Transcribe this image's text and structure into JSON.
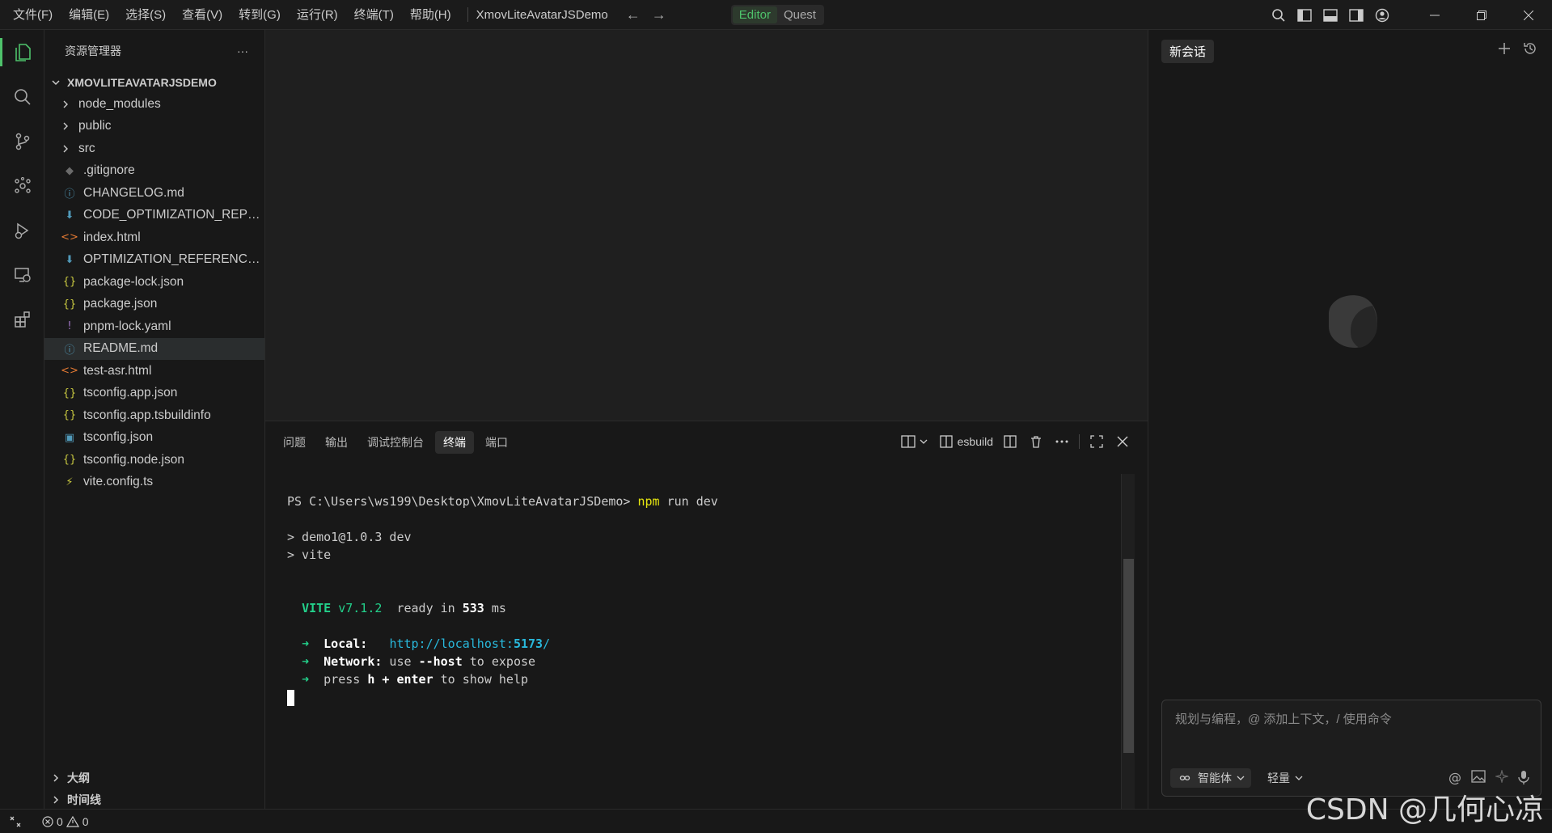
{
  "menu": [
    "文件(F)",
    "编辑(E)",
    "选择(S)",
    "查看(V)",
    "转到(G)",
    "运行(R)",
    "终端(T)",
    "帮助(H)"
  ],
  "window_title": "XmovLiteAvatarJSDemo",
  "modes": {
    "editor": "Editor",
    "quest": "Quest"
  },
  "sidebar": {
    "title": "资源管理器",
    "more": "···",
    "project": "XMOVLITEAVATARJSDEMO",
    "folders": [
      {
        "label": "node_modules"
      },
      {
        "label": "public"
      },
      {
        "label": "src"
      }
    ],
    "files": [
      {
        "label": ".gitignore",
        "icon": "◆",
        "color": "#6b6b6b"
      },
      {
        "label": "CHANGELOG.md",
        "icon": "ⓘ",
        "color": "#519aba"
      },
      {
        "label": "CODE_OPTIMIZATION_REPOR...",
        "icon": "⬇",
        "color": "#519aba"
      },
      {
        "label": "index.html",
        "icon": "<>",
        "color": "#e37933"
      },
      {
        "label": "OPTIMIZATION_REFERENCE.md",
        "icon": "⬇",
        "color": "#519aba"
      },
      {
        "label": "package-lock.json",
        "icon": "{}",
        "color": "#cbcb41"
      },
      {
        "label": "package.json",
        "icon": "{}",
        "color": "#cbcb41"
      },
      {
        "label": "pnpm-lock.yaml",
        "icon": "!",
        "color": "#a074c4"
      },
      {
        "label": "README.md",
        "icon": "ⓘ",
        "color": "#519aba",
        "selected": true
      },
      {
        "label": "test-asr.html",
        "icon": "<>",
        "color": "#e37933"
      },
      {
        "label": "tsconfig.app.json",
        "icon": "{}",
        "color": "#cbcb41"
      },
      {
        "label": "tsconfig.app.tsbuildinfo",
        "icon": "{}",
        "color": "#cbcb41"
      },
      {
        "label": "tsconfig.json",
        "icon": "▣",
        "color": "#519aba"
      },
      {
        "label": "tsconfig.node.json",
        "icon": "{}",
        "color": "#cbcb41"
      },
      {
        "label": "vite.config.ts",
        "icon": "⚡",
        "color": "#cbcb41"
      }
    ],
    "outline": "大纲",
    "timeline": "时间线"
  },
  "panel": {
    "tabs": [
      "问题",
      "输出",
      "调试控制台",
      "终端",
      "端口"
    ],
    "active_tab": "终端",
    "terminal_name": "esbuild"
  },
  "terminal": {
    "prompt": "PS C:\\Users\\ws199\\Desktop\\XmovLiteAvatarJSDemo> ",
    "cmd1": "npm",
    "cmd2": " run dev",
    "line1": "> demo1@1.0.3 dev",
    "line2": "> vite",
    "vite": "VITE",
    "version": " v7.1.2",
    "ready": "  ready in ",
    "ms_value": "533",
    "ms": " ms",
    "arrow": "➜",
    "local_label": "Local:",
    "local_url_a": "http://localhost:",
    "local_port": "5173",
    "local_url_b": "/",
    "network_label": "Network:",
    "network_a": " use ",
    "network_b": "--host",
    "network_c": " to expose",
    "help_a": "press ",
    "help_b": "h + enter",
    "help_c": " to show help"
  },
  "chat": {
    "tab": "新会话",
    "placeholder": "规划与编程，@ 添加上下文，/ 使用命令",
    "agent": "智能体",
    "model": "轻量"
  },
  "status": {
    "errors": "0",
    "warnings": "0"
  },
  "watermark": "CSDN @几何心凉"
}
